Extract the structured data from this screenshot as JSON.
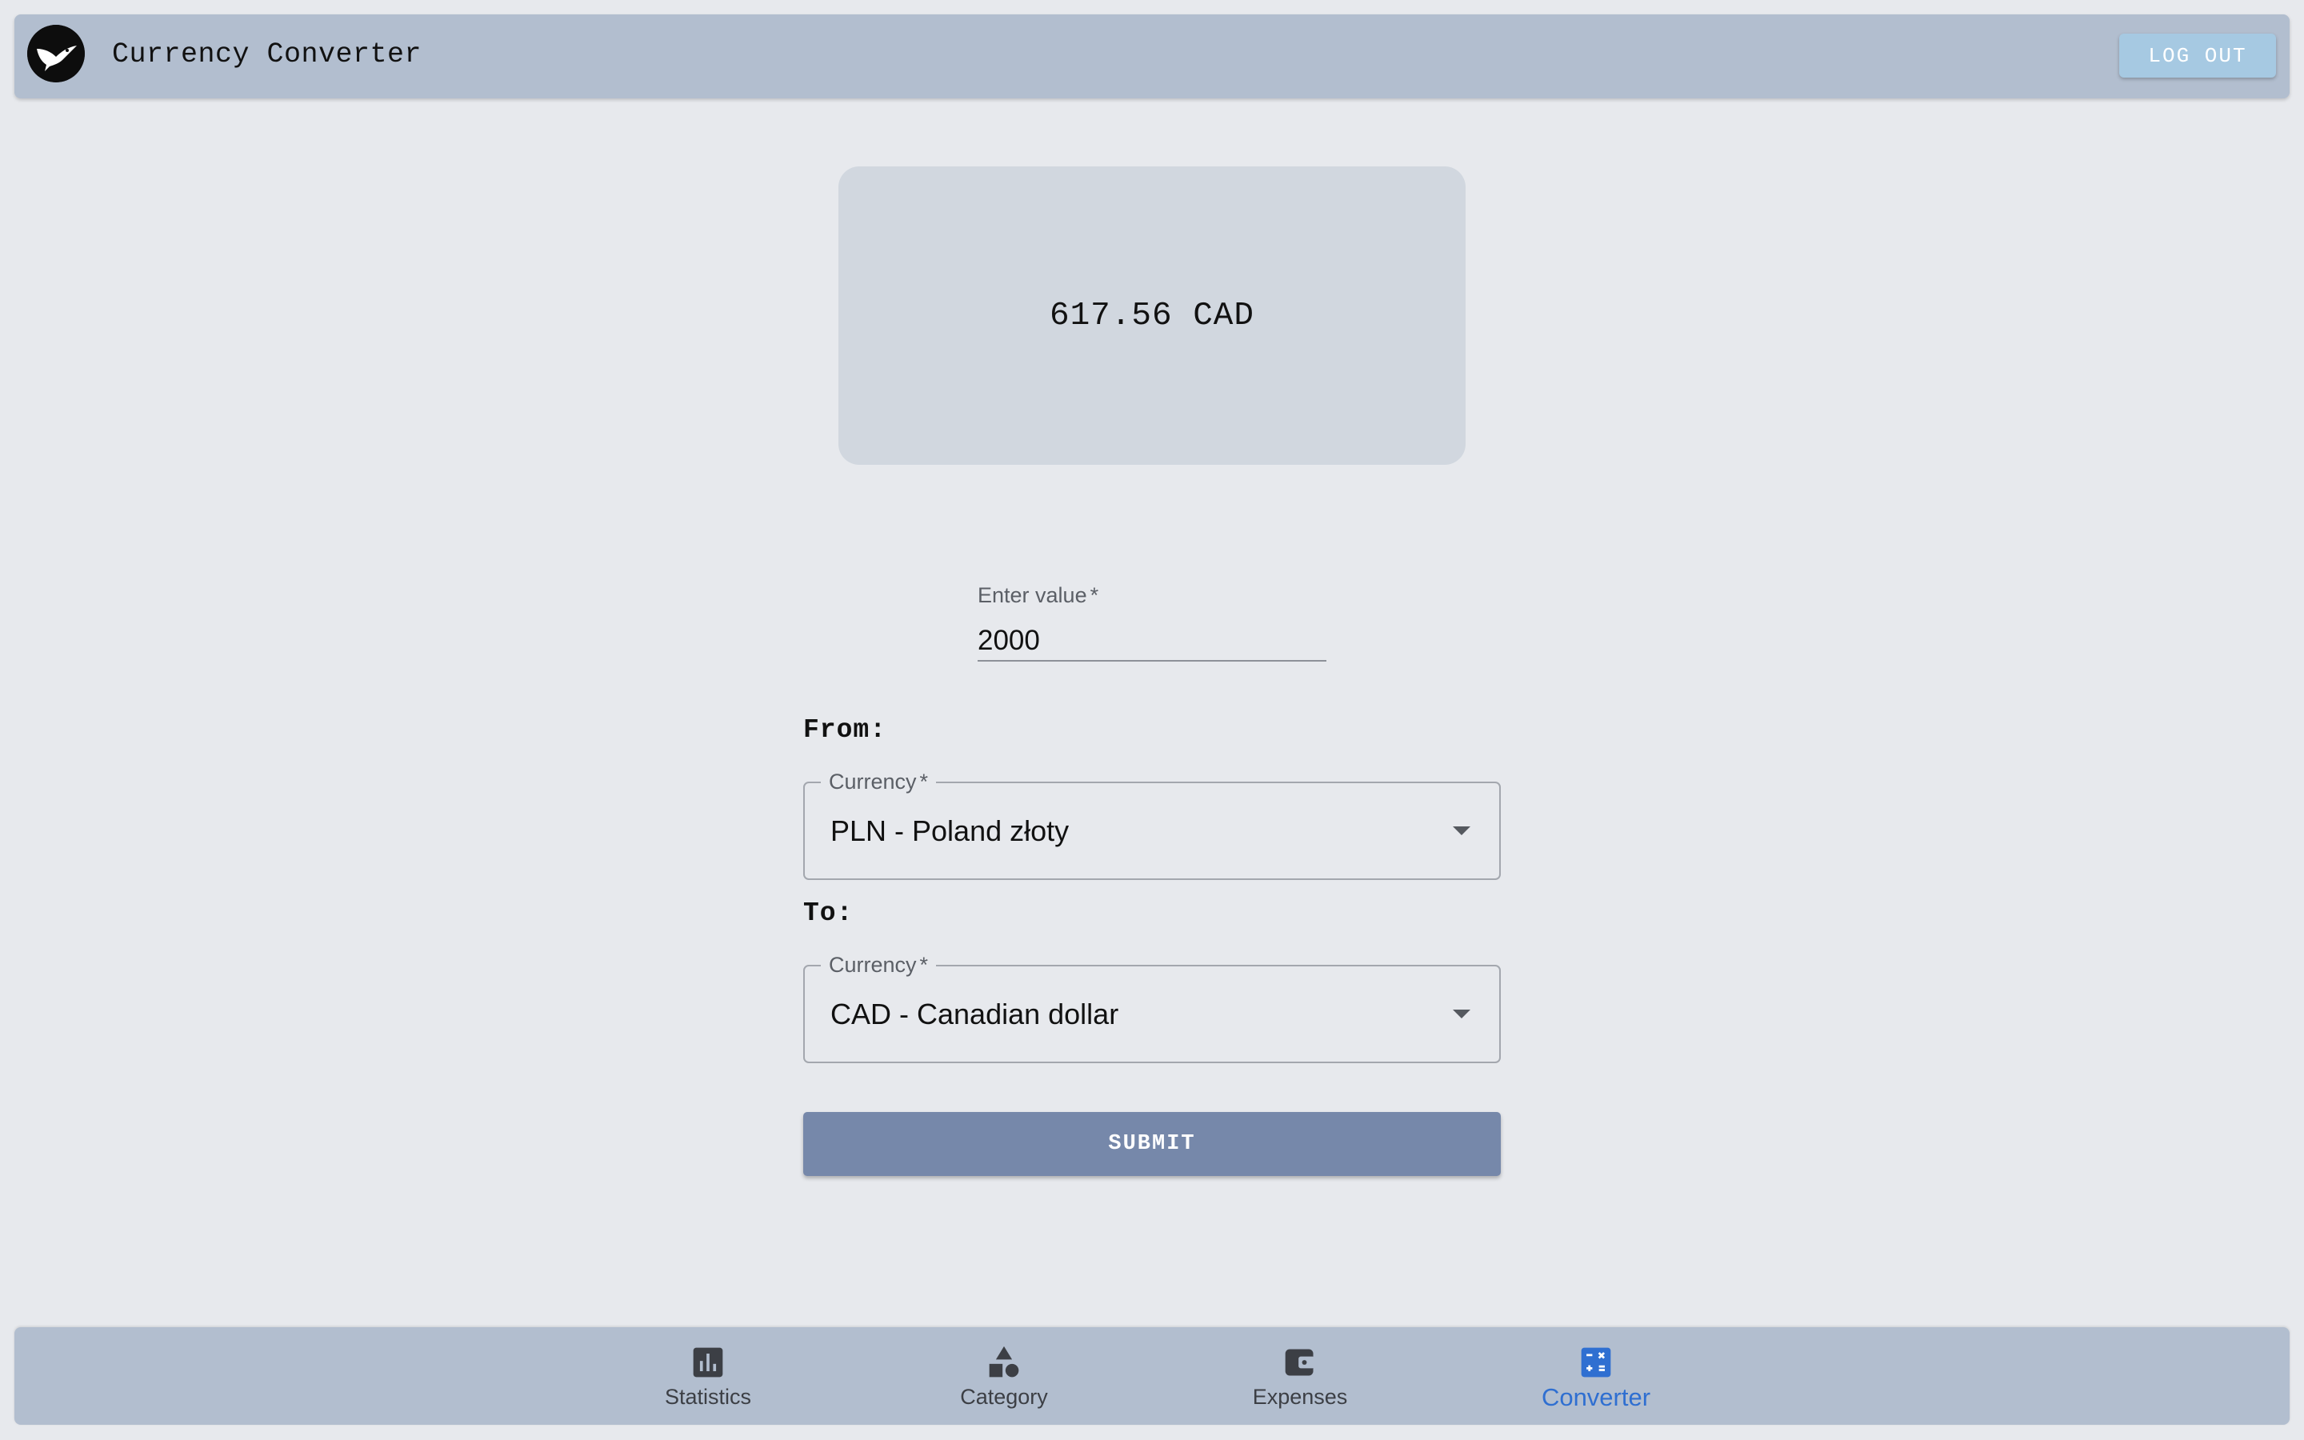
{
  "header": {
    "title": "Currency Converter",
    "logout_label": "LOG OUT",
    "logo_icon": "bird-logo-icon"
  },
  "result": {
    "value": "617.56 CAD"
  },
  "amount": {
    "label": "Enter value",
    "required_mark": "*",
    "value": "2000"
  },
  "from": {
    "section_label": "From:",
    "field_label": "Currency",
    "required_mark": "*",
    "selected": "PLN - Poland złoty"
  },
  "to": {
    "section_label": "To:",
    "field_label": "Currency",
    "required_mark": "*",
    "selected": "CAD - Canadian dollar"
  },
  "submit": {
    "label": "SUBMIT"
  },
  "bottom_nav": {
    "items": [
      {
        "label": "Statistics",
        "icon": "bar-chart-icon",
        "active": false
      },
      {
        "label": "Category",
        "icon": "shapes-icon",
        "active": false
      },
      {
        "label": "Expenses",
        "icon": "wallet-icon",
        "active": false
      },
      {
        "label": "Converter",
        "icon": "calculator-icon",
        "active": true
      }
    ]
  },
  "colors": {
    "background": "#e7e9ed",
    "bar": "#b2becf",
    "accent": "#2f6fd1",
    "submit": "#7688aa",
    "logout": "#a6c9e2"
  }
}
